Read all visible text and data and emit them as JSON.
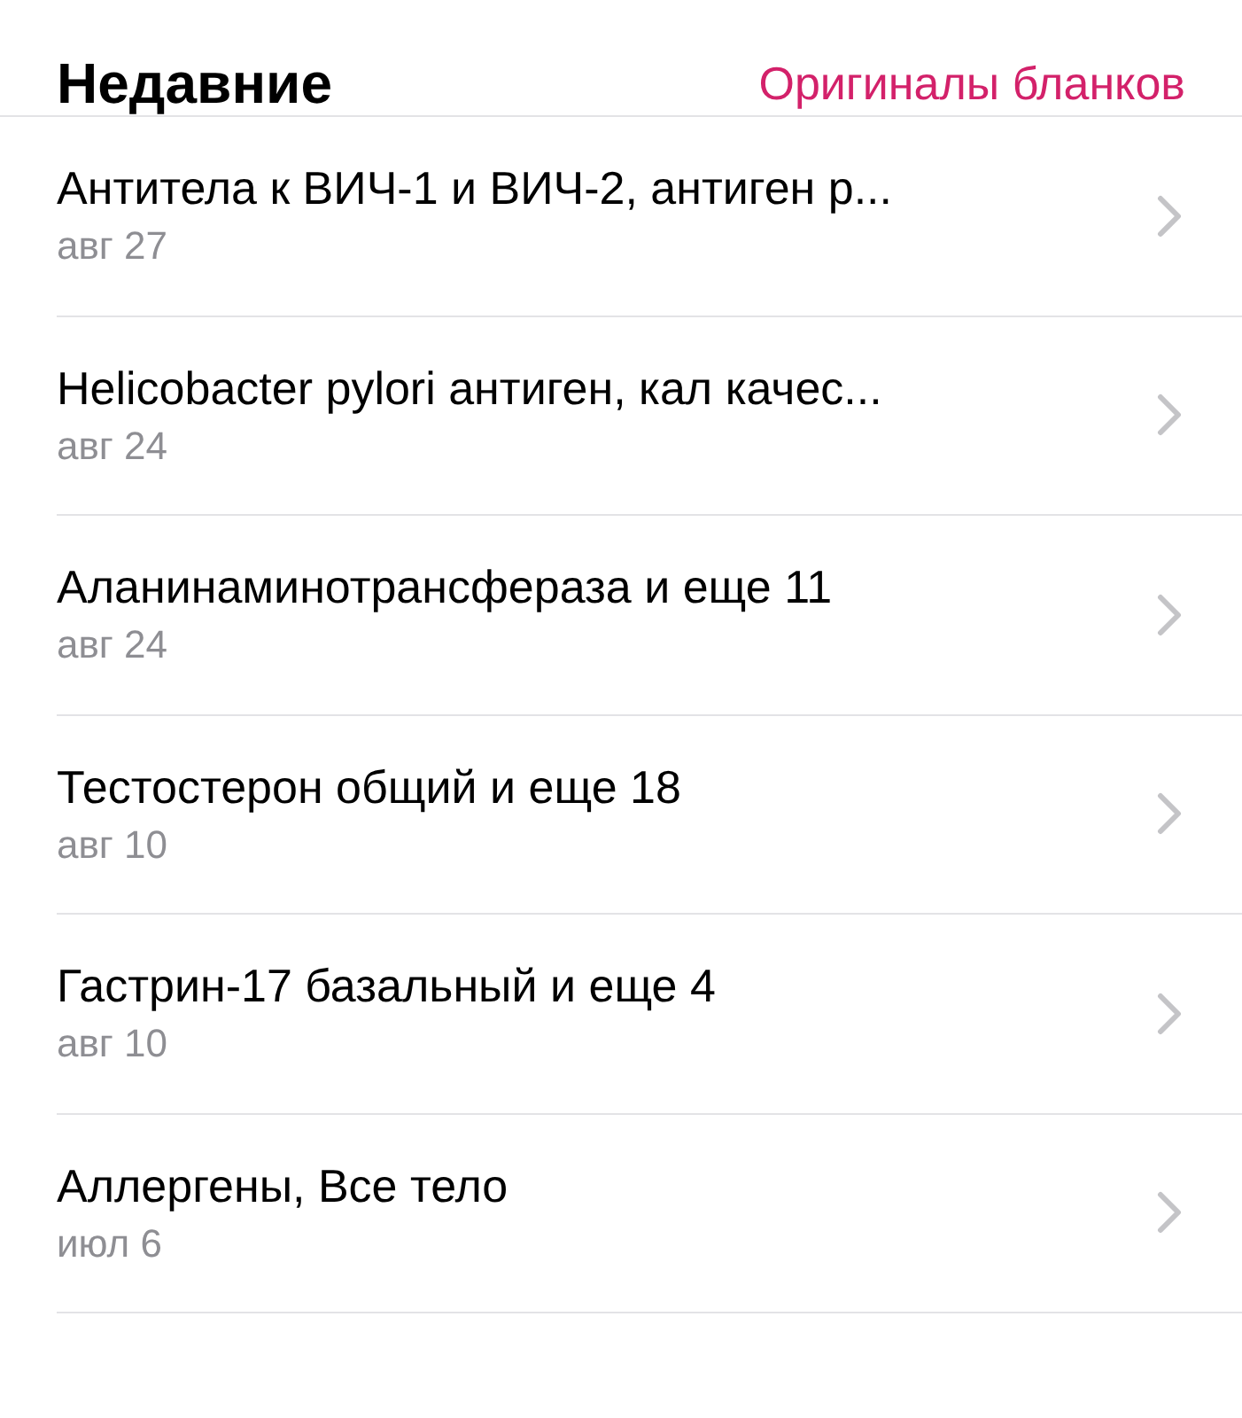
{
  "header": {
    "title": "Недавние",
    "link": "Оригиналы бланков"
  },
  "items": [
    {
      "title": "Антитела к ВИЧ-1 и ВИЧ-2, антиген р...",
      "date": "авг 27"
    },
    {
      "title": "Helicobacter pylori антиген, кал качес...",
      "date": "авг 24"
    },
    {
      "title": "Аланинаминотрансфераза и еще 11",
      "date": "авг 24"
    },
    {
      "title": "Тестостерон общий и еще 18",
      "date": "авг 10"
    },
    {
      "title": "Гастрин-17 базальный и еще 4",
      "date": "авг 10"
    },
    {
      "title": "Аллергены, Все тело",
      "date": "июл 6"
    }
  ]
}
